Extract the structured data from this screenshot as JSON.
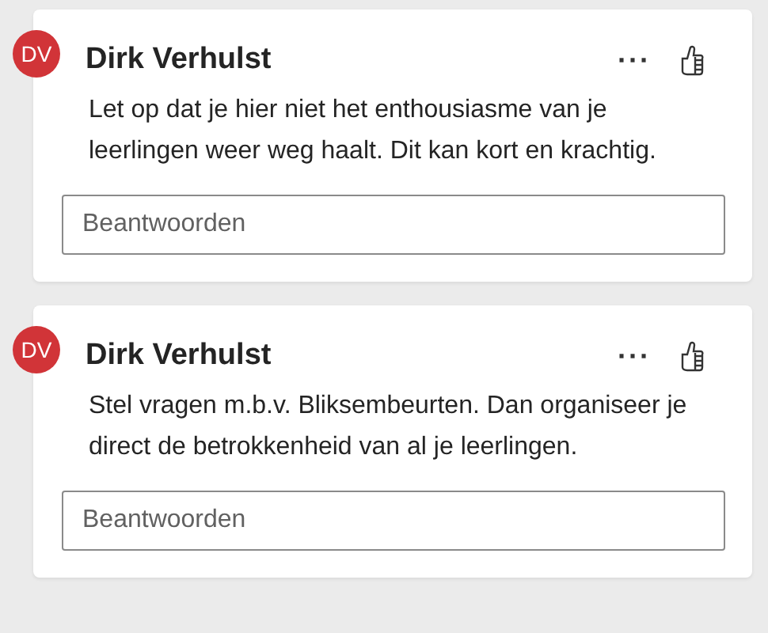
{
  "comments": [
    {
      "avatar": "DV",
      "author": "Dirk Verhulst",
      "more": "···",
      "text": "Let op dat je hier niet het enthousiasme van je leerlingen weer weg haalt. Dit kan kort en krachtig.",
      "reply": {
        "placeholder": "Beantwoorden"
      }
    },
    {
      "avatar": "DV",
      "author": "Dirk Verhulst",
      "more": "···",
      "text": "Stel vragen m.b.v. Bliksembeurten. Dan organiseer je direct de betrokkenheid van al je leerlingen.",
      "reply": {
        "placeholder": "Beantwoorden"
      }
    }
  ]
}
